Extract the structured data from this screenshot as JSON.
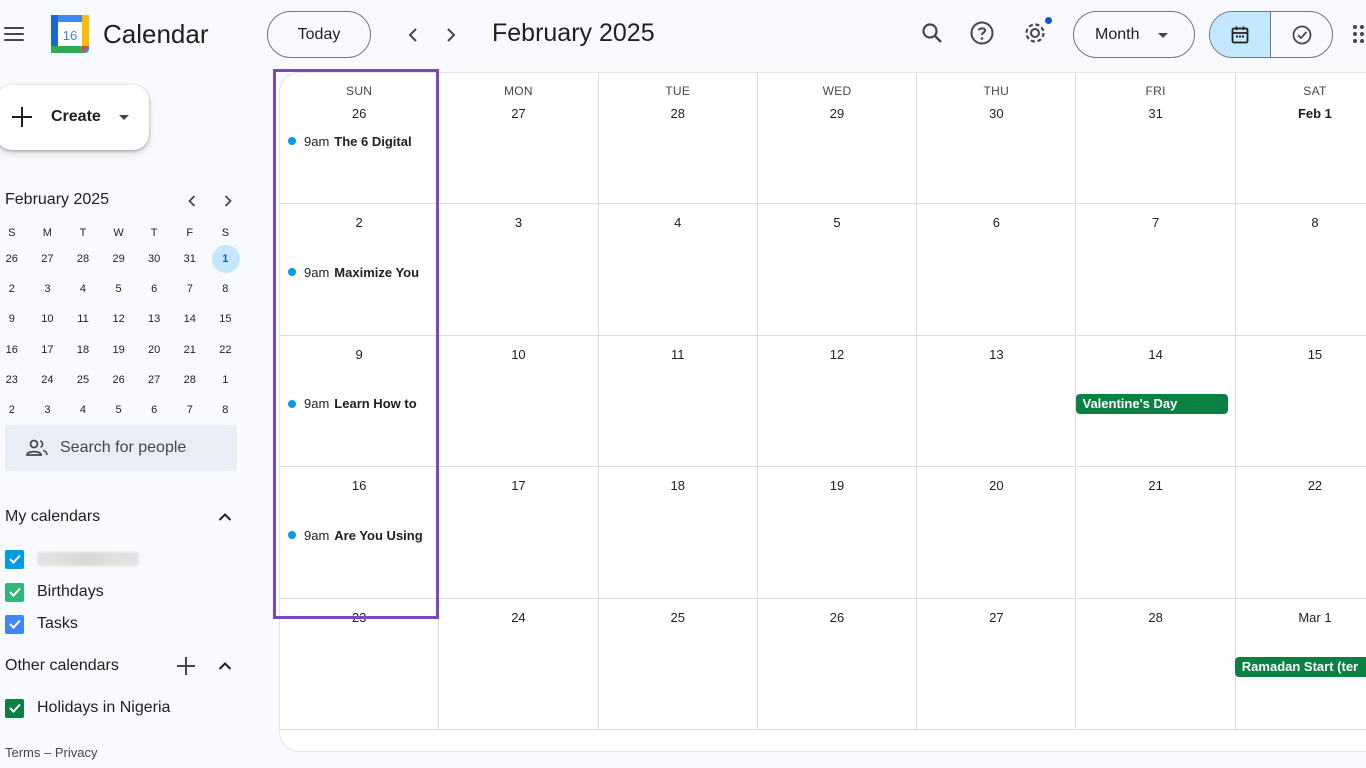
{
  "header": {
    "app_title": "Calendar",
    "logo_day": "16",
    "today_label": "Today",
    "period_title": "February 2025",
    "view_label": "Month",
    "icons": [
      "menu-icon",
      "search-icon",
      "help-icon",
      "settings-icon",
      "calendar-view-icon",
      "tasks-check-icon",
      "apps-grid-icon"
    ]
  },
  "sidebar": {
    "create_label": "Create",
    "mini_calendar": {
      "title": "February 2025",
      "weekdays": [
        "S",
        "M",
        "T",
        "W",
        "T",
        "F",
        "S"
      ],
      "weeks": [
        [
          "26",
          "27",
          "28",
          "29",
          "30",
          "31",
          "1"
        ],
        [
          "2",
          "3",
          "4",
          "5",
          "6",
          "7",
          "8"
        ],
        [
          "9",
          "10",
          "11",
          "12",
          "13",
          "14",
          "15"
        ],
        [
          "16",
          "17",
          "18",
          "19",
          "20",
          "21",
          "22"
        ],
        [
          "23",
          "24",
          "25",
          "26",
          "27",
          "28",
          "1"
        ],
        [
          "2",
          "3",
          "4",
          "5",
          "6",
          "7",
          "8"
        ]
      ],
      "selected": "1"
    },
    "search_people_placeholder": "Search for people",
    "my_calendars": {
      "title": "My calendars",
      "items": [
        {
          "label": "",
          "color": "#039be5",
          "redacted": true
        },
        {
          "label": "Birthdays",
          "color": "#33b679"
        },
        {
          "label": "Tasks",
          "color": "#4285f4"
        }
      ]
    },
    "other_calendars": {
      "title": "Other calendars",
      "items": [
        {
          "label": "Holidays in Nigeria",
          "color": "#0b8043"
        }
      ]
    },
    "footer": {
      "terms": "Terms",
      "sep": "–",
      "privacy": "Privacy"
    }
  },
  "month": {
    "weekdays": [
      "SUN",
      "MON",
      "TUE",
      "WED",
      "THU",
      "FRI",
      "SAT"
    ],
    "weeks": [
      [
        "26",
        "27",
        "28",
        "29",
        "30",
        "31",
        "Feb 1"
      ],
      [
        "2",
        "3",
        "4",
        "5",
        "6",
        "7",
        "8"
      ],
      [
        "9",
        "10",
        "11",
        "12",
        "13",
        "14",
        "15"
      ],
      [
        "16",
        "17",
        "18",
        "19",
        "20",
        "21",
        "22"
      ],
      [
        "23",
        "24",
        "25",
        "26",
        "27",
        "28",
        "Mar 1"
      ]
    ],
    "bold_dates": [
      "Feb 1"
    ],
    "events": [
      {
        "week": 0,
        "day": 0,
        "time": "9am",
        "title": "The 6 Digital"
      },
      {
        "week": 1,
        "day": 0,
        "time": "9am",
        "title": "Maximize You"
      },
      {
        "week": 2,
        "day": 0,
        "time": "9am",
        "title": "Learn How to"
      },
      {
        "week": 3,
        "day": 0,
        "time": "9am",
        "title": "Are You Using"
      }
    ],
    "all_day": [
      {
        "week": 2,
        "day": 5,
        "title": "Valentine's Day",
        "color": "#0b8043"
      },
      {
        "week": 4,
        "day": 6,
        "title": "Ramadan Start (ter",
        "color": "#0b8043"
      }
    ]
  },
  "colors": {
    "accent": "#0b57d0",
    "selection_fill": "#c2e7ff",
    "highlight_outline": "#7b49b7",
    "event_dot": "#039be5",
    "holiday_chip": "#0b8043"
  }
}
